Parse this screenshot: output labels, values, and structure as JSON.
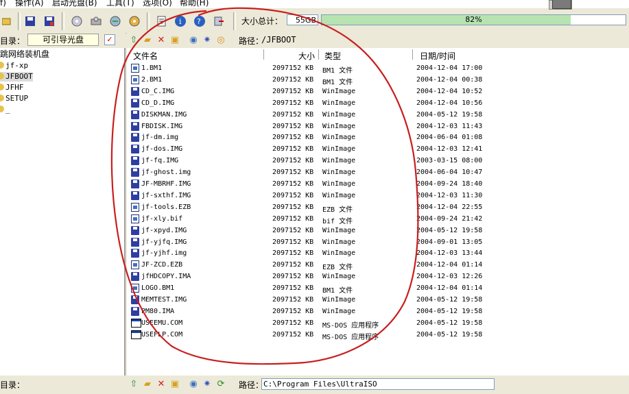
{
  "menu": [
    "f)",
    "操作(A)",
    "启动光盘(B)",
    "工具(T)",
    "选项(O)",
    "帮助(H)"
  ],
  "toolbar": {
    "size_label": "大小总计：",
    "size_value": "55GB",
    "progress_text": "82%",
    "progress_fraction": 0.82
  },
  "left": {
    "dir_label": "目录：",
    "dir_button": "可引导光盘",
    "tree": [
      {
        "label": "跳网络装机盘",
        "kind": "root"
      },
      {
        "label": "jf-xp"
      },
      {
        "label": "JFBOOT",
        "selected": true
      },
      {
        "label": "JFHF"
      },
      {
        "label": "SETUP"
      },
      {
        "label": "_"
      }
    ]
  },
  "right": {
    "path_label": "路径：",
    "path_value": "/JFBOOT",
    "columns": {
      "name": "文件名",
      "size": "大小",
      "type": "类型",
      "date": "日期/时间"
    },
    "files": [
      {
        "icon": "doc",
        "name": "1.BM1",
        "size": "2097152 KB",
        "type": "BM1 文件",
        "date": "2004-12-04 17:00"
      },
      {
        "icon": "doc",
        "name": "2.BM1",
        "size": "2097152 KB",
        "type": "BM1 文件",
        "date": "2004-12-04 00:38"
      },
      {
        "icon": "disk",
        "name": "CD_C.IMG",
        "size": "2097152 KB",
        "type": "WinImage",
        "date": "2004-12-04 10:52"
      },
      {
        "icon": "disk",
        "name": "CD_D.IMG",
        "size": "2097152 KB",
        "type": "WinImage",
        "date": "2004-12-04 10:56"
      },
      {
        "icon": "disk",
        "name": "DISKMAN.IMG",
        "size": "2097152 KB",
        "type": "WinImage",
        "date": "2004-05-12 19:58"
      },
      {
        "icon": "disk",
        "name": "FBDISK.IMG",
        "size": "2097152 KB",
        "type": "WinImage",
        "date": "2004-12-03 11:43"
      },
      {
        "icon": "disk",
        "name": "jf-dm.img",
        "size": "2097152 KB",
        "type": "WinImage",
        "date": "2004-06-04 01:08"
      },
      {
        "icon": "disk",
        "name": "jf-dos.IMG",
        "size": "2097152 KB",
        "type": "WinImage",
        "date": "2004-12-03 12:41"
      },
      {
        "icon": "disk",
        "name": "jf-fq.IMG",
        "size": "2097152 KB",
        "type": "WinImage",
        "date": "2003-03-15 08:00"
      },
      {
        "icon": "disk",
        "name": "jf-ghost.img",
        "size": "2097152 KB",
        "type": "WinImage",
        "date": "2004-06-04 10:47"
      },
      {
        "icon": "disk",
        "name": "JF-MBRHF.IMG",
        "size": "2097152 KB",
        "type": "WinImage",
        "date": "2004-09-24 18:40"
      },
      {
        "icon": "disk",
        "name": "jf-sxthf.IMG",
        "size": "2097152 KB",
        "type": "WinImage",
        "date": "2004-12-03 11:30"
      },
      {
        "icon": "doc",
        "name": "jf-tools.EZB",
        "size": "2097152 KB",
        "type": "EZB 文件",
        "date": "2004-12-04 22:55"
      },
      {
        "icon": "doc",
        "name": "jf-xly.bif",
        "size": "2097152 KB",
        "type": "bif 文件",
        "date": "2004-09-24 21:42"
      },
      {
        "icon": "disk",
        "name": "jf-xpyd.IMG",
        "size": "2097152 KB",
        "type": "WinImage",
        "date": "2004-05-12 19:58"
      },
      {
        "icon": "disk",
        "name": "jf-yjfq.IMG",
        "size": "2097152 KB",
        "type": "WinImage",
        "date": "2004-09-01 13:05"
      },
      {
        "icon": "disk",
        "name": "jf-yjhf.img",
        "size": "2097152 KB",
        "type": "WinImage",
        "date": "2004-12-03 13:44"
      },
      {
        "icon": "doc",
        "name": "JF-ZCD.EZB",
        "size": "2097152 KB",
        "type": "EZB 文件",
        "date": "2004-12-04 01:14"
      },
      {
        "icon": "disk",
        "name": "jfHDCOPY.IMA",
        "size": "2097152 KB",
        "type": "WinImage",
        "date": "2004-12-03 12:26"
      },
      {
        "icon": "doc",
        "name": "LOGO.BM1",
        "size": "2097152 KB",
        "type": "BM1 文件",
        "date": "2004-12-04 01:14"
      },
      {
        "icon": "disk",
        "name": "MEMTEST.IMG",
        "size": "2097152 KB",
        "type": "WinImage",
        "date": "2004-05-12 19:58"
      },
      {
        "icon": "disk",
        "name": "PM80.IMA",
        "size": "2097152 KB",
        "type": "WinImage",
        "date": "2004-05-12 19:58"
      },
      {
        "icon": "exe",
        "name": "USEEMU.COM",
        "size": "2097152 KB",
        "type": "MS-DOS 应用程序",
        "date": "2004-05-12 19:58"
      },
      {
        "icon": "exe",
        "name": "USEFLP.COM",
        "size": "2097152 KB",
        "type": "MS-DOS 应用程序",
        "date": "2004-05-12 19:58"
      }
    ]
  },
  "bottom": {
    "dir_label": "目录：",
    "path_label": "路径：",
    "path_value": "C:\\Program Files\\UltraISO"
  },
  "colors": {
    "progress_fill": "#b6e3b0",
    "annotation": "#c81e1e"
  }
}
